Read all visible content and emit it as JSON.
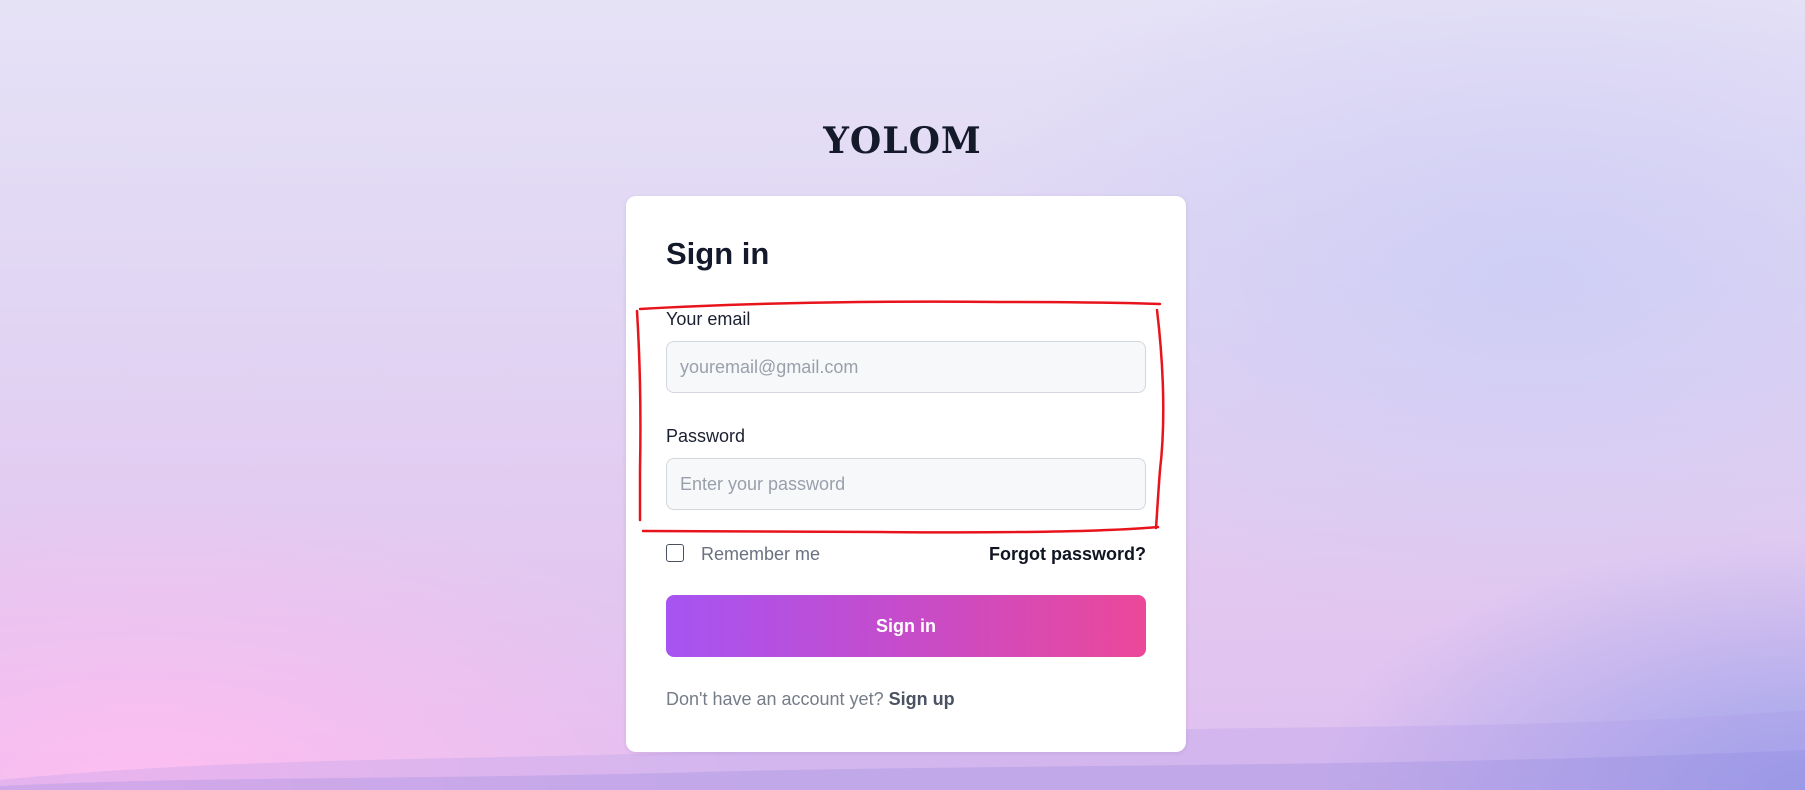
{
  "brand": {
    "logo_text": "YOLOM"
  },
  "form": {
    "title": "Sign in",
    "email_label": "Your email",
    "email_placeholder": "youremail@gmail.com",
    "email_value": "",
    "password_label": "Password",
    "password_placeholder": "Enter your password",
    "password_value": "",
    "remember_label": "Remember me",
    "remember_checked": false,
    "forgot_label": "Forgot password?",
    "submit_label": "Sign in",
    "signup_prompt": "Don't have an account yet?",
    "signup_label": "Sign up"
  },
  "colors": {
    "button_gradient_start": "#a855f7",
    "button_gradient_end": "#ec4899",
    "annotation": "#e8141c"
  },
  "annotation": {
    "shape": "hand-drawn rectangle around email and password fields",
    "color": "#e8141c"
  }
}
